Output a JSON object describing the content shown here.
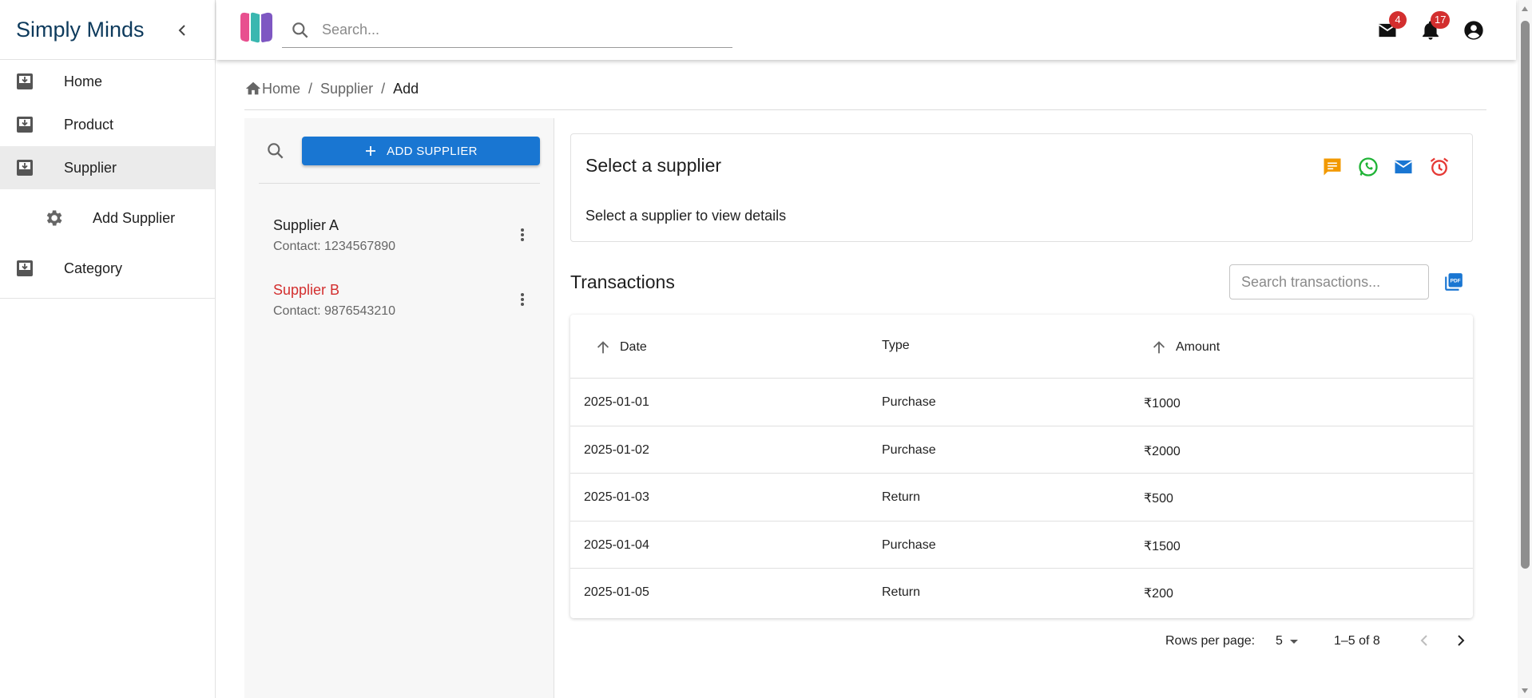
{
  "sidebar": {
    "brand": "Simply Minds",
    "items": [
      {
        "label": "Home",
        "icon": "inbox-download-icon"
      },
      {
        "label": "Product",
        "icon": "inbox-download-icon"
      },
      {
        "label": "Supplier",
        "icon": "inbox-download-icon",
        "active": true
      },
      {
        "label": "Add Supplier",
        "icon": "gear-icon",
        "sub": true
      },
      {
        "label": "Category",
        "icon": "inbox-download-icon"
      }
    ]
  },
  "topbar": {
    "search_placeholder": "Search...",
    "mail_count": "4",
    "notification_count": "17"
  },
  "breadcrumb": {
    "items": [
      "Home",
      "Supplier",
      "Add"
    ]
  },
  "suppliers": {
    "add_button_label": "ADD SUPPLIER",
    "list": [
      {
        "name": "Supplier A",
        "contact": "Contact: 1234567890"
      },
      {
        "name": "Supplier B",
        "contact": "Contact: 9876543210",
        "highlight": "#d32f2f"
      }
    ]
  },
  "details": {
    "title": "Select a supplier",
    "subtitle": "Select a supplier to view details",
    "actions": [
      "message-icon",
      "whatsapp-icon",
      "email-icon",
      "alarm-icon"
    ]
  },
  "transactions": {
    "title": "Transactions",
    "search_placeholder": "Search transactions...",
    "columns": [
      "Date",
      "Type",
      "Amount"
    ],
    "rows": [
      {
        "date": "2025-01-01",
        "type": "Purchase",
        "amount": "₹1000"
      },
      {
        "date": "2025-01-02",
        "type": "Purchase",
        "amount": "₹2000"
      },
      {
        "date": "2025-01-03",
        "type": "Return",
        "amount": "₹500"
      },
      {
        "date": "2025-01-04",
        "type": "Purchase",
        "amount": "₹1500"
      },
      {
        "date": "2025-01-05",
        "type": "Return",
        "amount": "₹200"
      }
    ]
  },
  "pagination": {
    "rows_per_page_label": "Rows per page:",
    "rows_per_page": "5",
    "range": "1–5 of 8"
  },
  "colors": {
    "accent": "#1976d2",
    "brand_text": "#0d3a5c",
    "danger": "#d32f2f",
    "message": "#f29900",
    "whatsapp": "#1fb336",
    "email": "#1976d2",
    "alarm": "#e53935"
  }
}
